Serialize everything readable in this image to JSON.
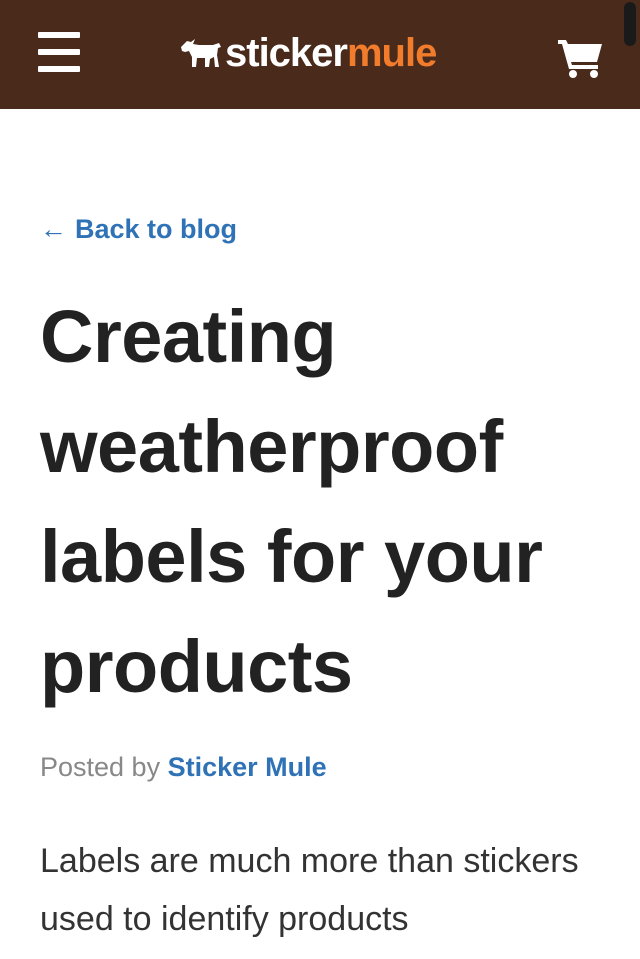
{
  "header": {
    "logo": {
      "part1": "sticker",
      "part2": "mule",
      "icon": "mule-icon"
    },
    "menu_icon": "hamburger-menu-icon",
    "cart_icon": "shopping-cart-icon"
  },
  "article": {
    "back_link_arrow": "←",
    "back_link": "Back to blog",
    "title": "Creating weatherproof labels for your products",
    "posted_by_prefix": "Posted by",
    "author": "Sticker Mule",
    "intro": "Labels are much more than stickers used to identify products"
  },
  "colors": {
    "header_bg": "#4a2a1b",
    "brand_orange": "#f07c2c",
    "link_blue": "#2f72b6",
    "text_dark": "#222222",
    "text_muted": "#888888"
  }
}
